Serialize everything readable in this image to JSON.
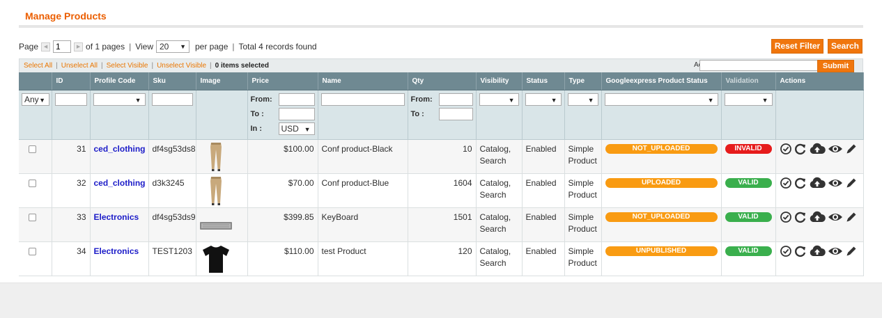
{
  "page_title": "Manage Products",
  "pager": {
    "page_label": "Page",
    "page_value": "1",
    "of_pages": "of 1 pages",
    "view_label": "View",
    "per_page_value": "20",
    "per_page_label": "per page",
    "total": "Total 4 records found"
  },
  "buttons": {
    "reset_filter": "Reset Filter",
    "search": "Search",
    "submit": "Submit"
  },
  "massaction": {
    "select_all": "Select All",
    "unselect_all": "Unselect All",
    "select_visible": "Select Visible",
    "unselect_visible": "Unselect Visible",
    "items_selected": "0 items selected",
    "actions_label": "Actions"
  },
  "columns": [
    "",
    "ID",
    "Profile Code",
    "Sku",
    "Image",
    "Price",
    "Name",
    "Qty",
    "Visibility",
    "Status",
    "Type",
    "Googleexpress Product Status",
    "Validation",
    "Actions"
  ],
  "filters": {
    "any": "Any",
    "from": "From:",
    "to": "To :",
    "in": "In :",
    "currency": "USD"
  },
  "rows": [
    {
      "id": "31",
      "profile": "ced_clothing",
      "sku": "df4sg53ds8",
      "image": "pants",
      "price": "$100.00",
      "name": "Conf product-Black",
      "qty": "10",
      "visibility_1": "Catalog,",
      "visibility_2": "Search",
      "status": "Enabled",
      "type_1": "Simple",
      "type_2": "Product",
      "gstatus": "NOT_UPLOADED",
      "validation": "INVALID",
      "validation_color": "#e61b1b"
    },
    {
      "id": "32",
      "profile": "ced_clothing",
      "sku": "d3k3245",
      "image": "pants",
      "price": "$70.00",
      "name": "Conf product-Blue",
      "qty": "1604",
      "visibility_1": "Catalog,",
      "visibility_2": "Search",
      "status": "Enabled",
      "type_1": "Simple",
      "type_2": "Product",
      "gstatus": "UPLOADED",
      "validation": "VALID",
      "validation_color": "#3aaf4d"
    },
    {
      "id": "33",
      "profile": "Electronics",
      "sku": "df4sg53ds9",
      "image": "keyboard",
      "price": "$399.85",
      "name": "KeyBoard",
      "qty": "1501",
      "visibility_1": "Catalog,",
      "visibility_2": "Search",
      "status": "Enabled",
      "type_1": "Simple",
      "type_2": "Product",
      "gstatus": "NOT_UPLOADED",
      "validation": "VALID",
      "validation_color": "#3aaf4d"
    },
    {
      "id": "34",
      "profile": "Electronics",
      "sku": "TEST1203",
      "image": "tshirt",
      "price": "$110.00",
      "name": "test Product",
      "qty": "120",
      "visibility_1": "Catalog,",
      "visibility_2": "Search",
      "status": "Enabled",
      "type_1": "Simple",
      "type_2": "Product",
      "gstatus": "UNPUBLISHED",
      "validation": "VALID",
      "validation_color": "#3aaf4d"
    }
  ],
  "action_icons": [
    "validate-icon",
    "sync-icon",
    "upload-icon",
    "view-icon",
    "edit-icon"
  ],
  "colors": {
    "accent": "#f0760d",
    "header": "#6f8992",
    "link": "#1c1cc8",
    "status_pill": "#f99b12"
  }
}
